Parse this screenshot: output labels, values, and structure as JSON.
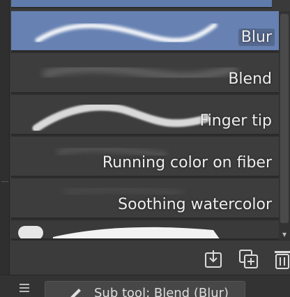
{
  "brushes": [
    {
      "label": "Blur",
      "selected": true
    },
    {
      "label": "Blend",
      "selected": false
    },
    {
      "label": "Finger tip",
      "selected": false
    },
    {
      "label": "Running color on fiber",
      "selected": false
    },
    {
      "label": "Soothing watercolor",
      "selected": false
    }
  ],
  "toolbar": {
    "import_icon": "import-icon",
    "duplicate_icon": "duplicate-icon",
    "delete_icon": "trash-icon"
  },
  "bottom_bar": {
    "current_tool_label": "Sub tool: Blend (Blur)"
  },
  "colors": {
    "selected_row": "#6681b2",
    "row": "#3d3d3d",
    "background": "#3a3a3a",
    "text": "#eeeeee"
  }
}
